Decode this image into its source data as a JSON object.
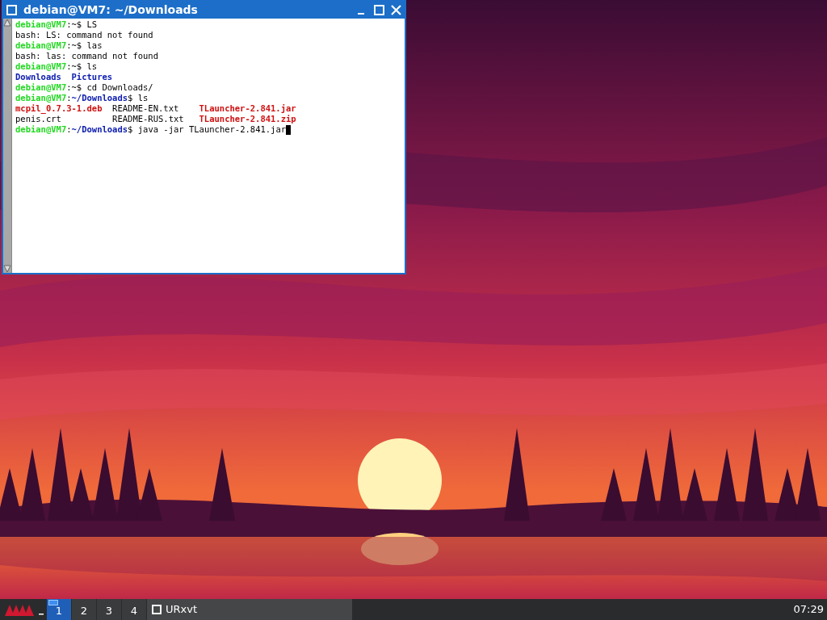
{
  "window": {
    "title": "debian@VM7: ~/Downloads"
  },
  "terminal": {
    "lines": [
      {
        "kind": "text",
        "segments": [
          {
            "kind": "prompt",
            "text": "debian@VM7"
          },
          {
            "kind": "plain",
            "text": ":~$ LS"
          }
        ]
      },
      {
        "kind": "text",
        "segments": [
          {
            "kind": "plain",
            "text": "bash: LS: command not found"
          }
        ]
      },
      {
        "kind": "text",
        "segments": [
          {
            "kind": "prompt",
            "text": "debian@VM7"
          },
          {
            "kind": "plain",
            "text": ":~$ las"
          }
        ]
      },
      {
        "kind": "text",
        "segments": [
          {
            "kind": "plain",
            "text": "bash: las: command not found"
          }
        ]
      },
      {
        "kind": "text",
        "segments": [
          {
            "kind": "prompt",
            "text": "debian@VM7"
          },
          {
            "kind": "plain",
            "text": ":~$ ls"
          }
        ]
      },
      {
        "kind": "listing",
        "segments": [
          {
            "kind": "dir",
            "text": "Downloads"
          },
          {
            "kind": "dir",
            "text": "Pictures"
          }
        ]
      },
      {
        "kind": "text",
        "segments": [
          {
            "kind": "prompt",
            "text": "debian@VM7"
          },
          {
            "kind": "plain",
            "text": ":~$ cd Downloads/"
          }
        ]
      },
      {
        "kind": "text",
        "segments": [
          {
            "kind": "prompt",
            "text": "debian@VM7"
          },
          {
            "kind": "plain",
            "text": ":"
          },
          {
            "kind": "dir",
            "text": "~/Downloads"
          },
          {
            "kind": "plain",
            "text": "$ ls"
          }
        ]
      },
      {
        "kind": "listing",
        "segments": [
          {
            "kind": "archive",
            "text": "mcpil_0.7.3-1.deb"
          },
          {
            "kind": "plain",
            "text": "README-EN.txt"
          },
          {
            "kind": "archive",
            "text": "TLauncher-2.841.jar"
          }
        ]
      },
      {
        "kind": "listing",
        "segments": [
          {
            "kind": "plain",
            "text": "penis.crt"
          },
          {
            "kind": "plain",
            "text": "README-RUS.txt"
          },
          {
            "kind": "archive",
            "text": "TLauncher-2.841.zip"
          }
        ]
      },
      {
        "kind": "input",
        "segments": [
          {
            "kind": "prompt",
            "text": "debian@VM7"
          },
          {
            "kind": "plain",
            "text": ":"
          },
          {
            "kind": "dir",
            "text": "~/Downloads"
          },
          {
            "kind": "plain",
            "text": "$ java -jar TLauncher-2.841.jar"
          }
        ]
      }
    ]
  },
  "taskbar": {
    "workspaces": [
      {
        "label": "1",
        "selected": true
      },
      {
        "label": "2",
        "selected": false
      },
      {
        "label": "3",
        "selected": false
      },
      {
        "label": "4",
        "selected": false
      }
    ],
    "tasks": [
      {
        "label": "URxvt"
      }
    ],
    "clock": "07:29"
  }
}
